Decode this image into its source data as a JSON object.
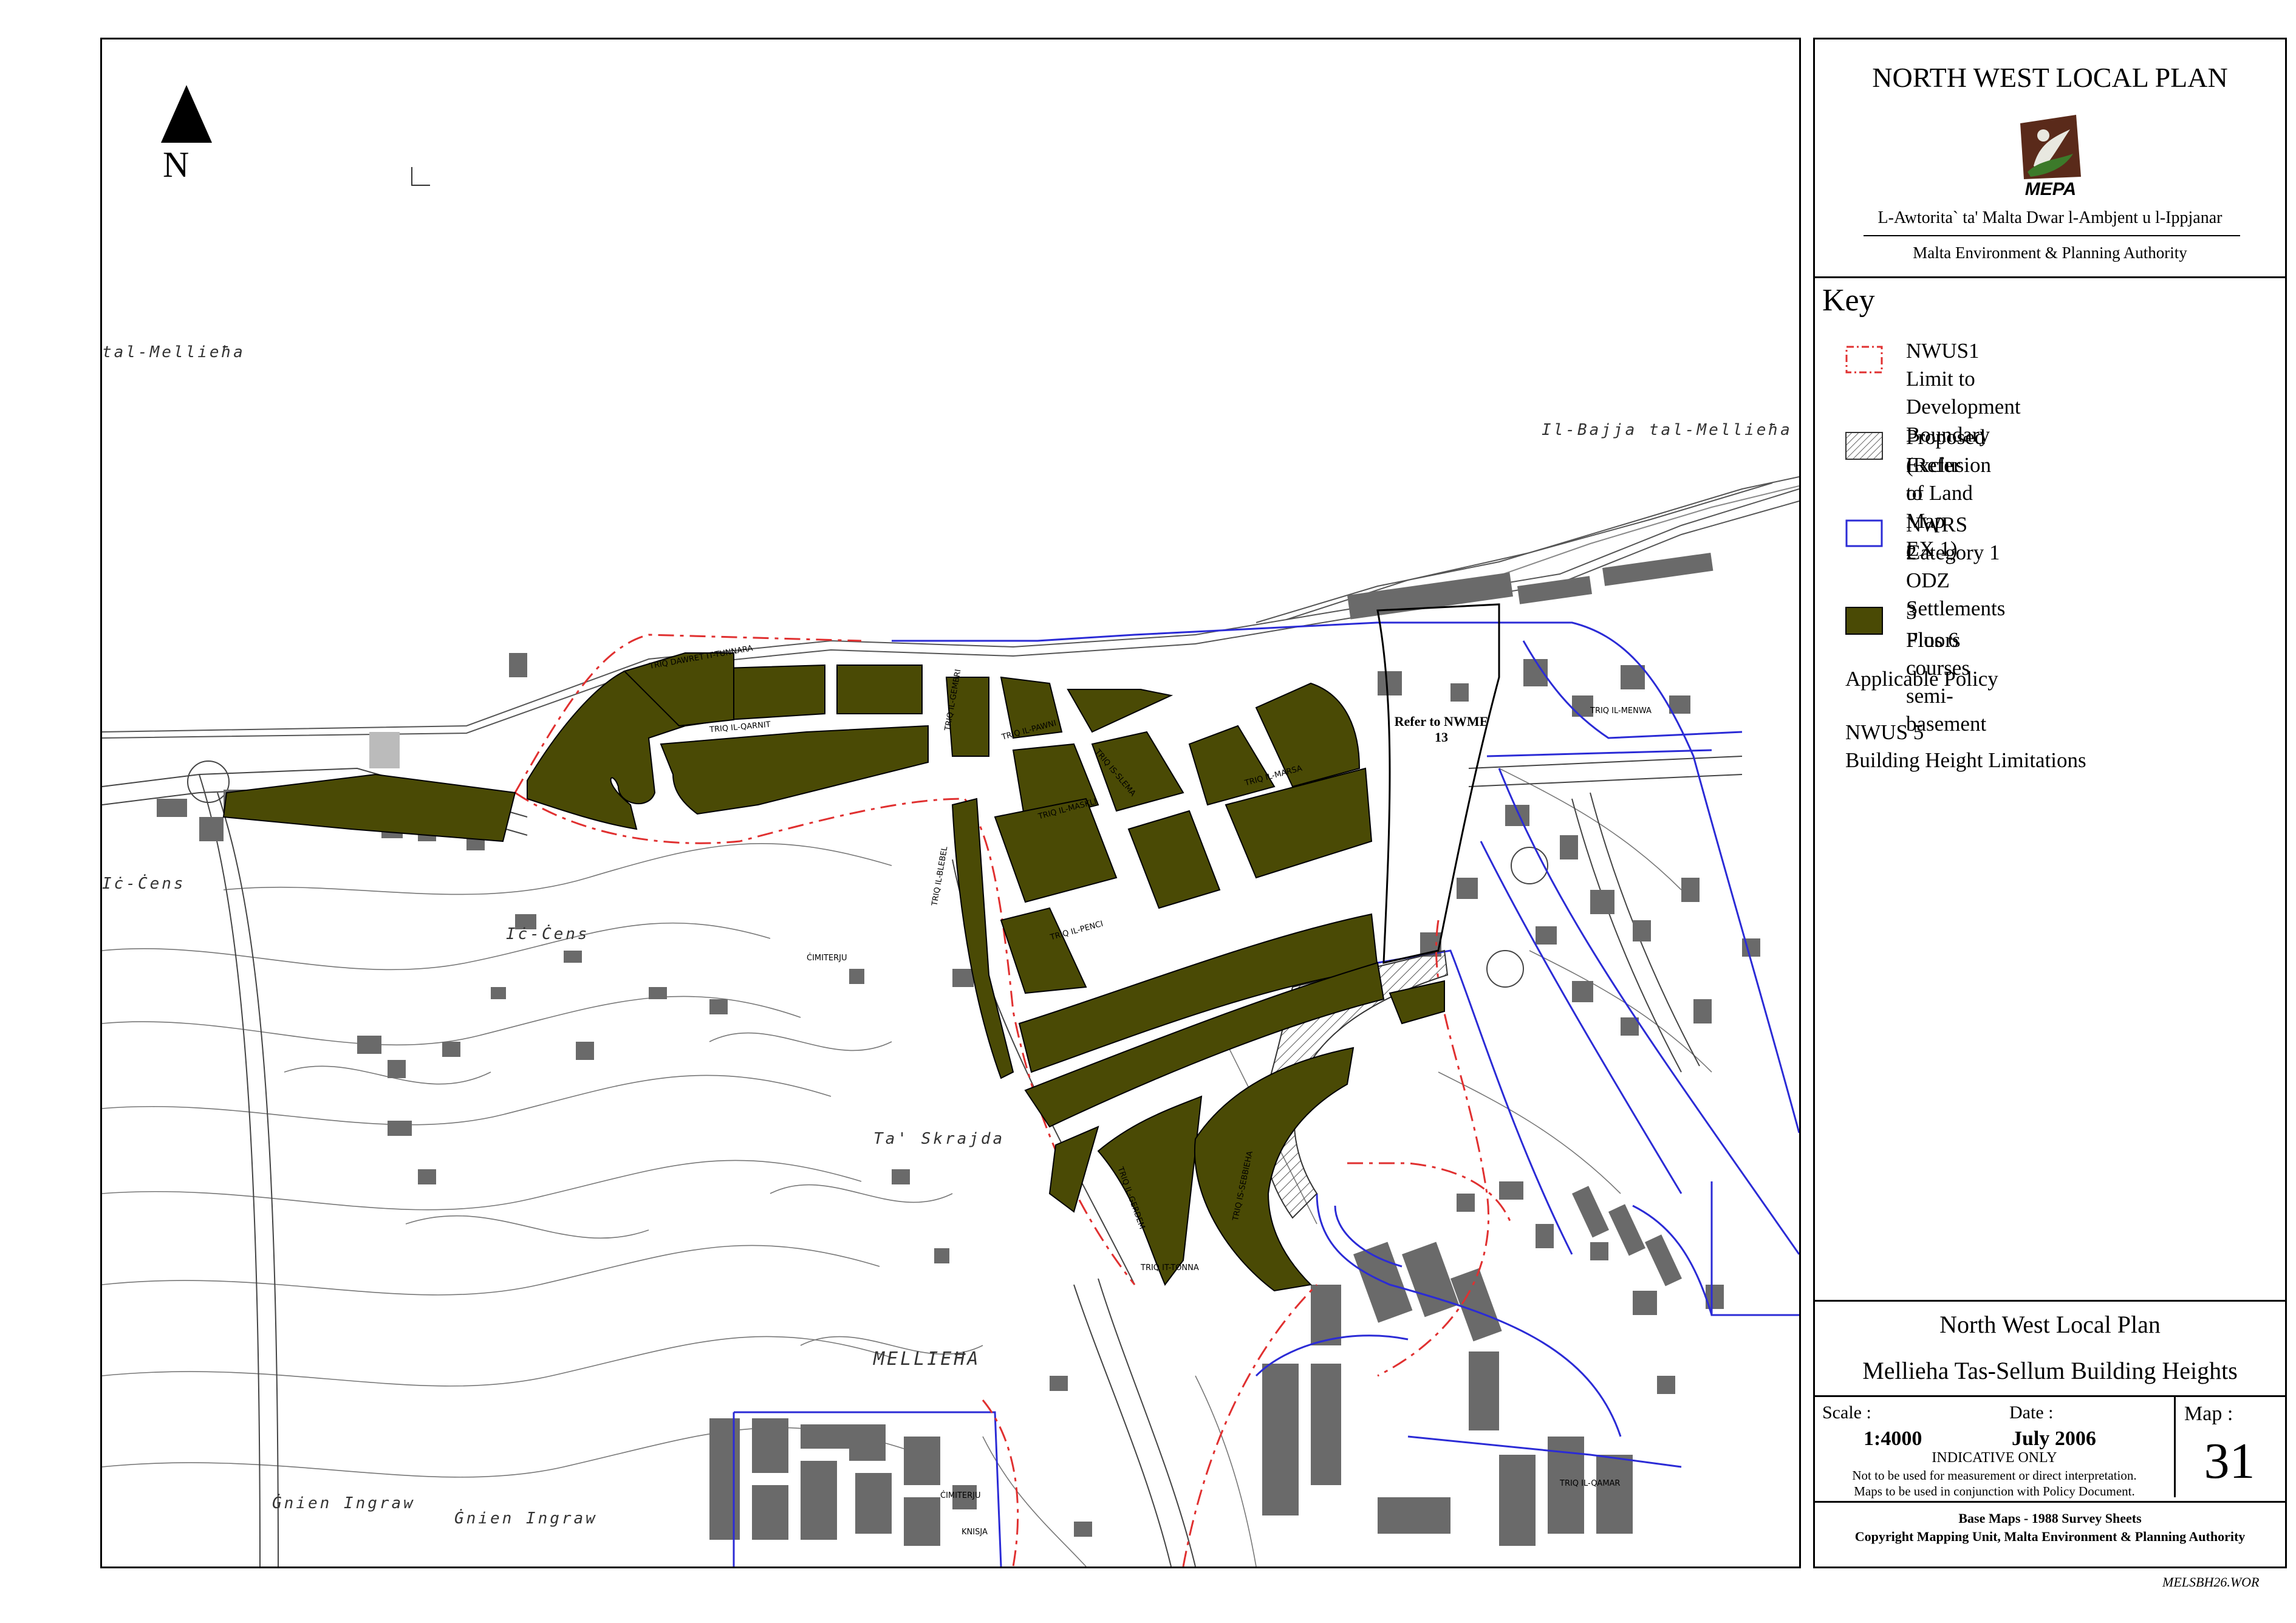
{
  "map": {
    "north_label": "N",
    "place_labels": {
      "tal_mellieha": "tal-Mellieħa",
      "il_bajja": "Il-Bajja tal-Mellieħa",
      "ic_cens_1": "Iċ-Ċens",
      "ic_cens_2": "Iċ-Ċens",
      "ta_skrajda": "Ta' Skrajda",
      "mellieha": "MELLIEĦA",
      "gnien_ingraw_1": "Ġnien Ingraw",
      "gnien_ingraw_2": "Ġnien Ingraw",
      "cimiterju_1": "ĊIMITERJU",
      "cimiterju_2": "ĊIMITERJU",
      "knisja": "KNISJA"
    },
    "street_labels": {
      "s1": "TRIQ DAWRET IT-TUNNARA",
      "s2": "TRIQ IL-QARNIT",
      "s3": "TRIQ IL-PAWNI",
      "s4": "TRIQ IL-GEMBRI",
      "s5": "TRIQ IL-PENCI",
      "s6": "TRIQ IL-MASKLI",
      "s7": "TRIQ IS-SLEMA",
      "s8": "TRIQ IL-MARSA",
      "s9": "TRIQ IL-BLEBEL",
      "s10": "TRIQ IL-MENWA",
      "s11": "TRIQ IT-TONNA",
      "s12": "TRIQ IS-SEBBIEHA",
      "s13": "TRIQ IL-GERDEM",
      "s14": "TRIQ IL-QAMAR"
    },
    "refer_note": "Refer to NWME 13"
  },
  "panel": {
    "title": "NORTH WEST LOCAL PLAN",
    "logo_text": "MEPA",
    "authority_maltese": "L-Awtorita` ta' Malta Dwar l-Ambjent u l-Ippjanar",
    "authority_english": "Malta Environment & Planning Authority",
    "key_heading": "Key",
    "key_items": [
      {
        "line1": "NWUS1",
        "line2": "Limit to Development Boundary"
      },
      {
        "line1": "Proposed Exclusion of Land",
        "line2": "(Refer to Map EX 1)"
      },
      {
        "line1": "NWRS 2",
        "line2": "Category 1 ODZ Settlements"
      },
      {
        "line1": "3 Floors",
        "line2": "Plus 6 courses semi-basement"
      }
    ],
    "applicable_policy_label": "Applicable Policy",
    "policy_code": "NWUS 5",
    "policy_name": "Building Height Limitations",
    "plan_name": "North West Local Plan",
    "map_title": "Mellieha Tas-Sellum Building Heights",
    "scale_label": "Scale :",
    "scale_value": "1:4000",
    "date_label": "Date :",
    "date_value": "July 2006",
    "indicative": "INDICATIVE ONLY",
    "disclaimer_1": "Not to be used for measurement or direct interpretation.",
    "disclaimer_2": "Maps to be used in conjunction with Policy Document.",
    "map_label": "Map :",
    "map_number": "31",
    "base_maps": "Base Maps - 1988 Survey Sheets",
    "copyright": "Copyright Mapping Unit, Malta Environment & Planning Authority"
  },
  "file_code": "MELSBH26.WOR",
  "colors": {
    "zone_fill": "#4a4a05",
    "boundary_red": "#e03030",
    "odz_blue": "#2b2bd6",
    "building_grey": "#6a6a6a"
  }
}
